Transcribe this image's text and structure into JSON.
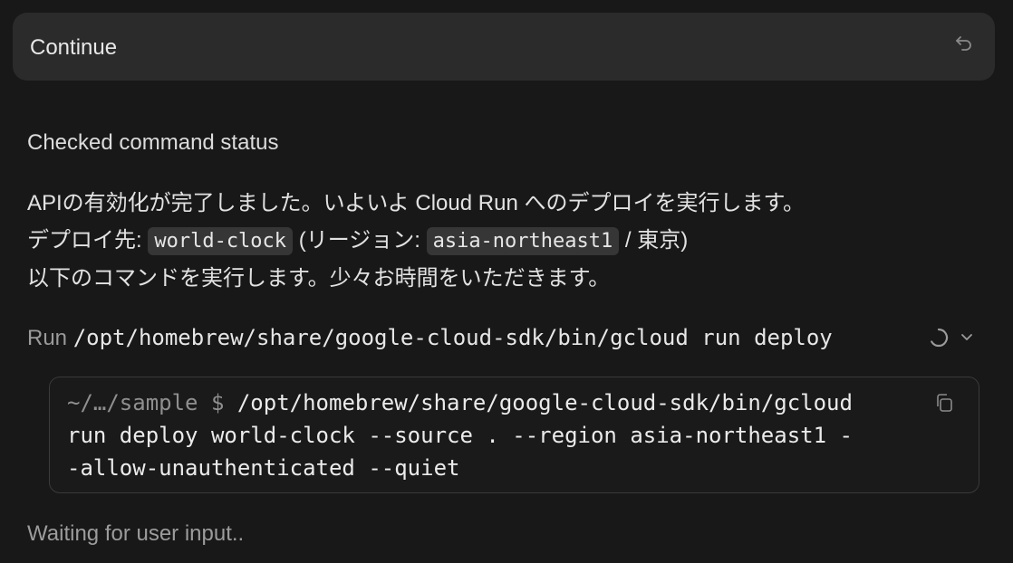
{
  "user_message": {
    "text": "Continue",
    "undo_icon": "undo-icon"
  },
  "status": {
    "text": "Checked command status"
  },
  "assistant_message": {
    "line1": "APIの有効化が完了しました。いよいよ Cloud Run へのデプロイを実行します。",
    "line2_prefix": "デプロイ先: ",
    "service_name": "world-clock",
    "line2_middle": " (リージョン: ",
    "region": "asia-northeast1",
    "line2_suffix": " / 東京)",
    "line3": "以下のコマンドを実行します。少々お時間をいただきます。"
  },
  "run_step": {
    "label": "Run",
    "command": "/opt/homebrew/share/google-cloud-sdk/bin/gcloud run deploy",
    "spinner_icon": "spinner-icon",
    "expand_icon": "chevron-down-icon"
  },
  "terminal": {
    "prompt": "~/…/sample $ ",
    "line1": "/opt/homebrew/share/google-cloud-sdk/bin/gcloud",
    "line2": "run deploy world-clock --source . --region asia-northeast1 -",
    "line3": "-allow-unauthenticated --quiet",
    "copy_icon": "copy-icon"
  },
  "footer": {
    "waiting": "Waiting for user input.."
  },
  "colors": {
    "background": "#181818",
    "bubble": "#2b2b2b",
    "chip": "#363636",
    "muted_text": "#9a9a9a",
    "border": "#3a3a3a"
  }
}
